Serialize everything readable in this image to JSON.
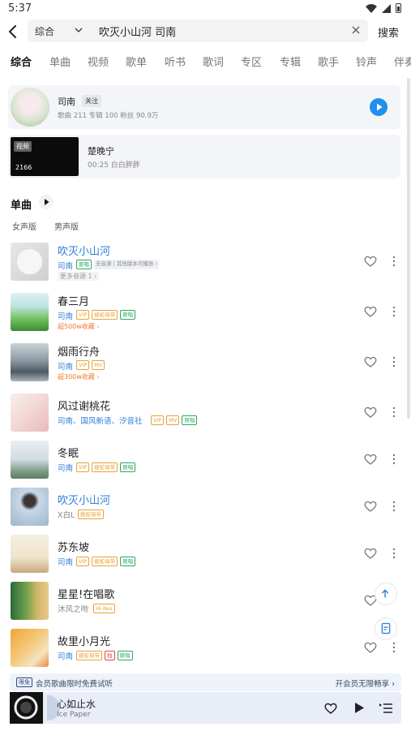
{
  "status": {
    "time": "5:37"
  },
  "search": {
    "scope": "综合",
    "query": "吹灭小山河 司南",
    "button": "搜索"
  },
  "tabs": [
    "综合",
    "单曲",
    "视频",
    "歌单",
    "听书",
    "歌词",
    "专区",
    "专辑",
    "歌手",
    "铃声",
    "伴奏"
  ],
  "artist": {
    "name": "司南",
    "follow": "关注",
    "stats": "歌曲 211    专辑 100    粉丝 90.9万"
  },
  "video": {
    "badge": "视频",
    "count": "2166",
    "title": "楚晚宁",
    "meta": "00:25 白白胖胖"
  },
  "singles": {
    "title": "单曲",
    "filters": [
      "女声版",
      "男声版"
    ]
  },
  "songs": [
    {
      "title": "吹灭小山河",
      "artist": "司南",
      "tags": [
        "原唱"
      ],
      "note": "无音源 | 其他版本可播放 ›",
      "sub": "更多音源 1 ›",
      "highlight": true
    },
    {
      "title": "春三月",
      "artist": "司南",
      "tags": [
        "VIP",
        "蝰蛇母带",
        "原唱"
      ],
      "sub": "超500w收藏 ›",
      "highlight": false
    },
    {
      "title": "烟雨行舟",
      "artist": "司南",
      "tags": [
        "VIP",
        "MV"
      ],
      "sub": "超300w收藏 ›",
      "highlight": false
    },
    {
      "title": "风过谢桃花",
      "artist": "司南、国风新语、汐音社",
      "tags": [
        "VIP",
        "MV",
        "原唱"
      ],
      "highlight": false
    },
    {
      "title": "冬眠",
      "artist": "司南",
      "tags": [
        "VIP",
        "蝰蛇母带",
        "原唱"
      ],
      "highlight": false
    },
    {
      "title": "吹灭小山河",
      "artist": "X白L",
      "tags": [
        "蝰蛇母带"
      ],
      "highlight": true
    },
    {
      "title": "苏东坡",
      "artist": "司南",
      "tags": [
        "VIP",
        "蝰蛇母带",
        "原唱"
      ],
      "highlight": false
    },
    {
      "title": "星星!在唱歌",
      "artist": "沐风之吻",
      "tags": [
        "Hi-Res"
      ],
      "highlight": false
    },
    {
      "title": "故里小月光",
      "artist": "司南",
      "tags": [
        "蝰蛇母带",
        "独",
        "原唱"
      ],
      "highlight": false
    }
  ],
  "vip_banner": {
    "badge": "限免",
    "text": "会员歌曲限时免费试听",
    "cta": "开会员无限畅享 ›"
  },
  "player": {
    "title": "心如止水",
    "artist": "Ice Paper"
  },
  "colors": {
    "accent": "#2d7fd8",
    "play": "#1f8ff0",
    "vip": "#e8a23a",
    "original": "#2ca862"
  }
}
